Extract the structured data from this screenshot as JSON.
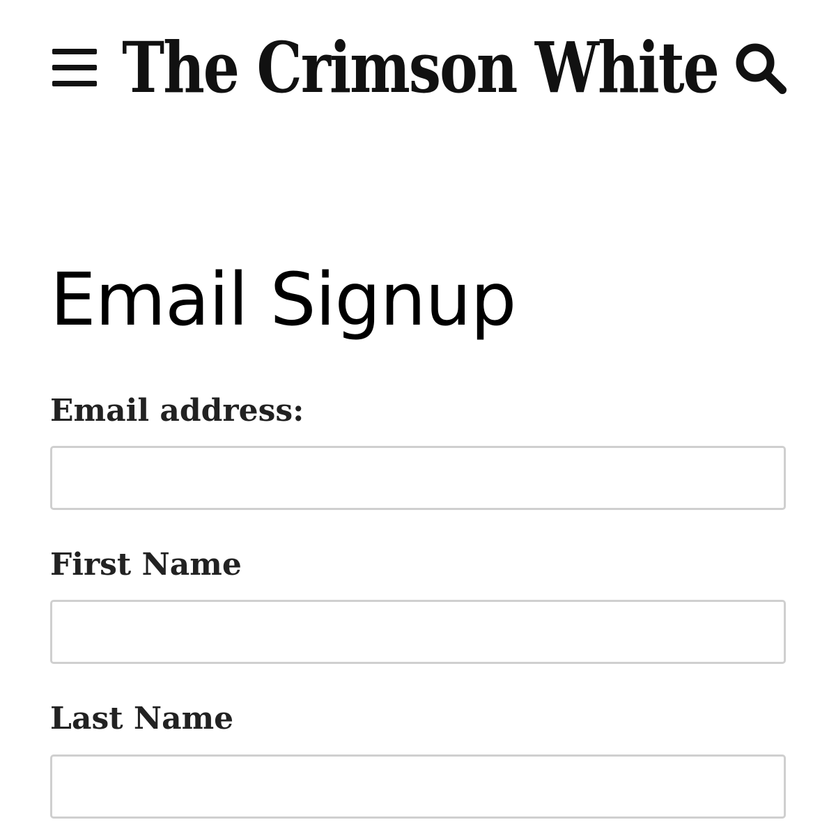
{
  "header": {
    "menu_icon": "hamburger-menu-icon",
    "logo_text": "The Crimson White",
    "search_icon": "search-icon"
  },
  "main": {
    "title": "Email Signup",
    "fields": [
      {
        "label": "Email address:",
        "value": "",
        "placeholder": ""
      },
      {
        "label": "First Name",
        "value": "",
        "placeholder": ""
      },
      {
        "label": "Last Name",
        "value": "",
        "placeholder": ""
      }
    ]
  },
  "colors": {
    "text": "#111111",
    "label": "#222222",
    "input_border": "#cfcfcf",
    "background": "#ffffff"
  }
}
